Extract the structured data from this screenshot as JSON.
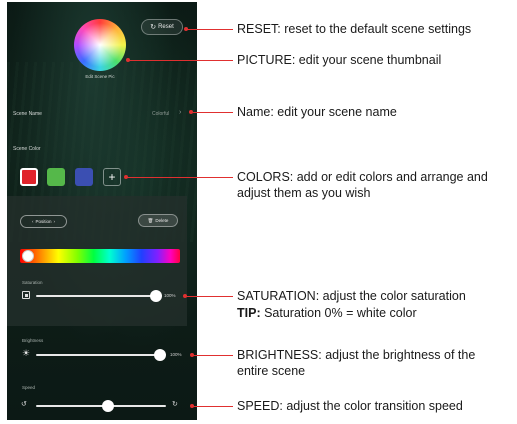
{
  "app": {
    "reset_label": "Reset",
    "reset_icon": "refresh-icon",
    "thumbnail_caption": "Edit Scene Pic",
    "scene_name_label": "Scene Name",
    "scene_name_value": "Colorful",
    "scene_color_label": "Scene Color",
    "swatches": [
      {
        "name": "red",
        "color": "#e0242b",
        "selected": true
      },
      {
        "name": "green",
        "color": "#55b84a",
        "selected": false
      },
      {
        "name": "blue",
        "color": "#3b4fb2",
        "selected": false
      }
    ],
    "add_color_label": "+",
    "position_label": "Position",
    "delete_label": "Delete",
    "saturation_label": "Saturation",
    "saturation_value": "100%",
    "saturation_fraction": 1.0,
    "brightness_label": "Brightness",
    "brightness_value": "100%",
    "brightness_fraction": 1.0,
    "speed_label": "Speed",
    "speed_fraction": 0.55,
    "spectrum_position_fraction": 0.0
  },
  "callouts": {
    "reset": "RESET: reset to the default scene settings",
    "picture": "PICTURE: edit your scene thumbnail",
    "name": "Name: edit your scene name",
    "colors": "COLORS: add or edit colors and arrange and adjust them as you wish",
    "saturation": "SATURATION: adjust the color saturation",
    "tip_key": "TIP:",
    "tip_text": "Saturation 0% = white color",
    "brightness": "BRIGHTNESS: adjust the brightness of the entire scene",
    "speed": "SPEED: adjust the color transition speed"
  },
  "colors": {
    "callout_line": "#e03030"
  }
}
